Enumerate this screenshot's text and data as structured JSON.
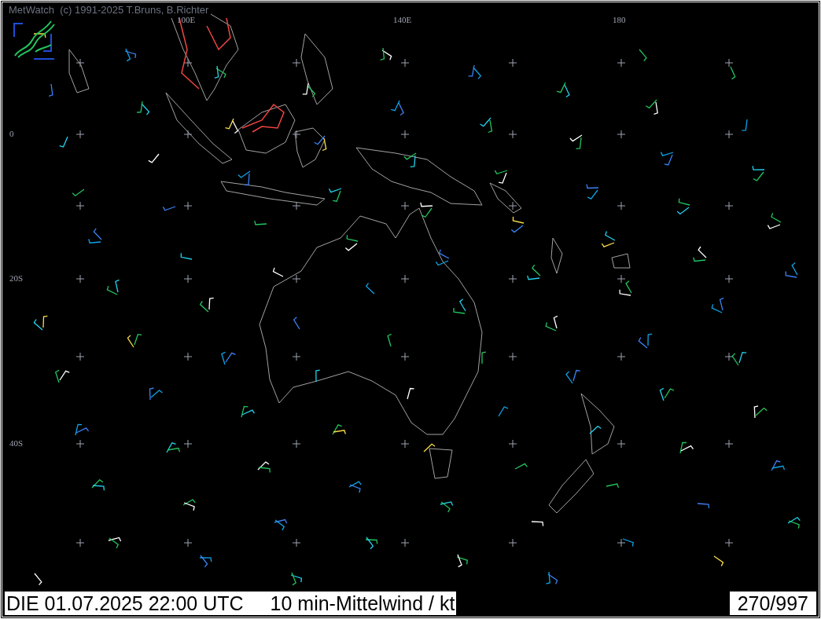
{
  "header": {
    "title": "MetWatch  (c) 1991-2025 T.Bruns, B.Richter"
  },
  "map": {
    "longitude_labels": [
      "100E",
      "140E",
      "180"
    ],
    "latitude_labels": [
      "0",
      "20S",
      "40S"
    ]
  },
  "status_bar": {
    "date_time": "DIE 01.07.2025 22:00 UTC",
    "product": "10 min-Mittelwind / kt",
    "station_count": "270/997"
  }
}
